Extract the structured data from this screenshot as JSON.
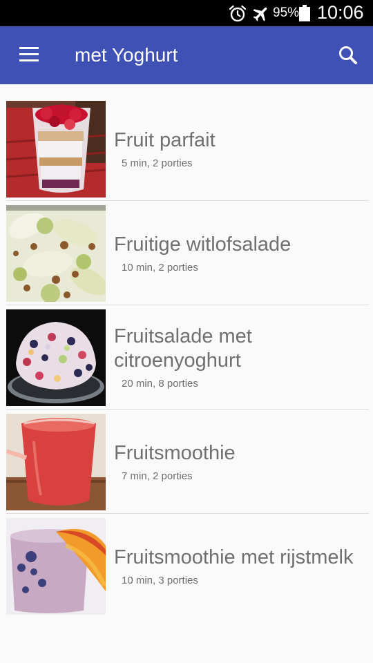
{
  "status_bar": {
    "battery_percent": "95%",
    "time": "10:06",
    "icons": [
      "alarm-icon",
      "airplane-mode-icon",
      "battery-icon"
    ]
  },
  "app_bar": {
    "title": "met Yoghurt",
    "menu_icon": "menu-icon",
    "search_icon": "search-icon",
    "color": "#3f51b5"
  },
  "recipes": [
    {
      "name": "Fruit parfait",
      "meta": "5 min, 2 porties"
    },
    {
      "name": "Fruitige witlofsalade",
      "meta": "10 min, 2 porties"
    },
    {
      "name": "Fruitsalade met citroenyoghurt",
      "meta": "20 min, 8 porties"
    },
    {
      "name": "Fruitsmoothie",
      "meta": "7 min, 2 porties"
    },
    {
      "name": "Fruitsmoothie met rijstmelk",
      "meta": "10 min, 3 porties"
    }
  ]
}
